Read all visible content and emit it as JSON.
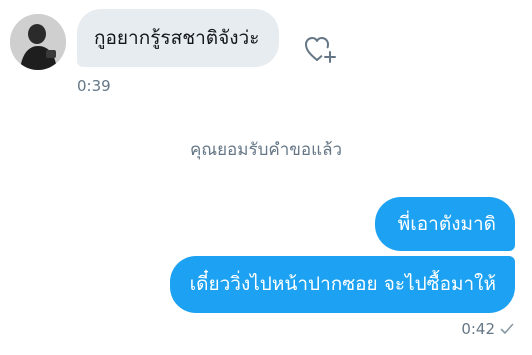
{
  "conversation": {
    "incoming": {
      "avatar_icon": "user-avatar-photo",
      "text": "กูอยากรู้รสชาติจังว่ะ",
      "timestamp": "0:39",
      "like_icon": "heart-plus-icon"
    },
    "system_message": "คุณยอมรับคำขอแล้ว",
    "outgoing": [
      {
        "text": "พี่เอาตังมาดิ"
      },
      {
        "text": "เดี๋ยววิ่งไปหน้าปากซอย จะไปซื้อมาให้"
      }
    ],
    "outgoing_timestamp": "0:42",
    "outgoing_status_icon": "sent-check-icon"
  },
  "colors": {
    "outgoing_bubble": "#1da1f2",
    "incoming_bubble": "#e6ecf0",
    "meta_text": "#657786"
  }
}
